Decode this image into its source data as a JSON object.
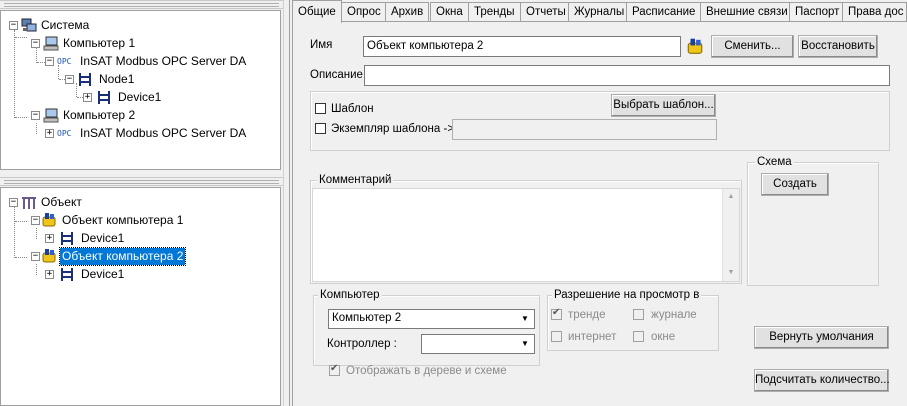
{
  "tree_top": {
    "nodes": [
      {
        "label": "Система",
        "icon": "system-icon"
      },
      {
        "label": "Компьютер 1",
        "icon": "computer-icon"
      },
      {
        "label": "InSAT Modbus OPC Server DA",
        "icon": "opc-icon",
        "badge": "OPC"
      },
      {
        "label": "Node1",
        "icon": "node-icon"
      },
      {
        "label": "Device1",
        "icon": "device-icon"
      },
      {
        "label": "Компьютер 2",
        "icon": "computer-icon"
      },
      {
        "label": "InSAT Modbus OPC Server DA",
        "icon": "opc-icon",
        "badge": "OPC"
      }
    ]
  },
  "tree_bottom": {
    "nodes": [
      {
        "label": "Объект",
        "icon": "object-root-icon"
      },
      {
        "label": "Объект компьютера 1",
        "icon": "object-computer-icon"
      },
      {
        "label": "Device1",
        "icon": "device-icon"
      },
      {
        "label": "Объект компьютера 2",
        "icon": "object-computer-icon",
        "selected": true
      },
      {
        "label": "Device1",
        "icon": "device-icon"
      }
    ]
  },
  "tabs": [
    "Общие",
    "Опрос",
    "Архив",
    "Окна",
    "Тренды",
    "Отчеты",
    "Журналы",
    "Расписание",
    "Внешние связи",
    "Паспорт",
    "Права дос"
  ],
  "active_tab": "Общие",
  "form": {
    "name_label": "Имя",
    "name_value": "Объект компьютера 2",
    "change_btn": "Сменить...",
    "restore_btn": "Восстановить",
    "desc_label": "Описание",
    "desc_value": "",
    "template_label": "Шаблон",
    "choose_template_btn": "Выбрать шаблон...",
    "instance_label": "Экземпляр шаблона ->",
    "scheme_group": "Схема",
    "create_btn": "Создать",
    "comment_group": "Комментарий",
    "computer_group": "Компьютер",
    "computer_value": "Компьютер 2",
    "controller_label": "Контроллер :",
    "controller_value": "",
    "view_group": "Разрешение на просмотр в",
    "trend_label": "тренде",
    "journal_label": "журнале",
    "internet_label": "интернет",
    "window_label": "окне",
    "show_tree_label": "Отображать в дереве и схеме",
    "defaults_btn": "Вернуть умолчания",
    "count_btn": "Подсчитать количество..."
  },
  "colors": {
    "selection": "#0078d7",
    "panel": "#f0f0f0"
  }
}
